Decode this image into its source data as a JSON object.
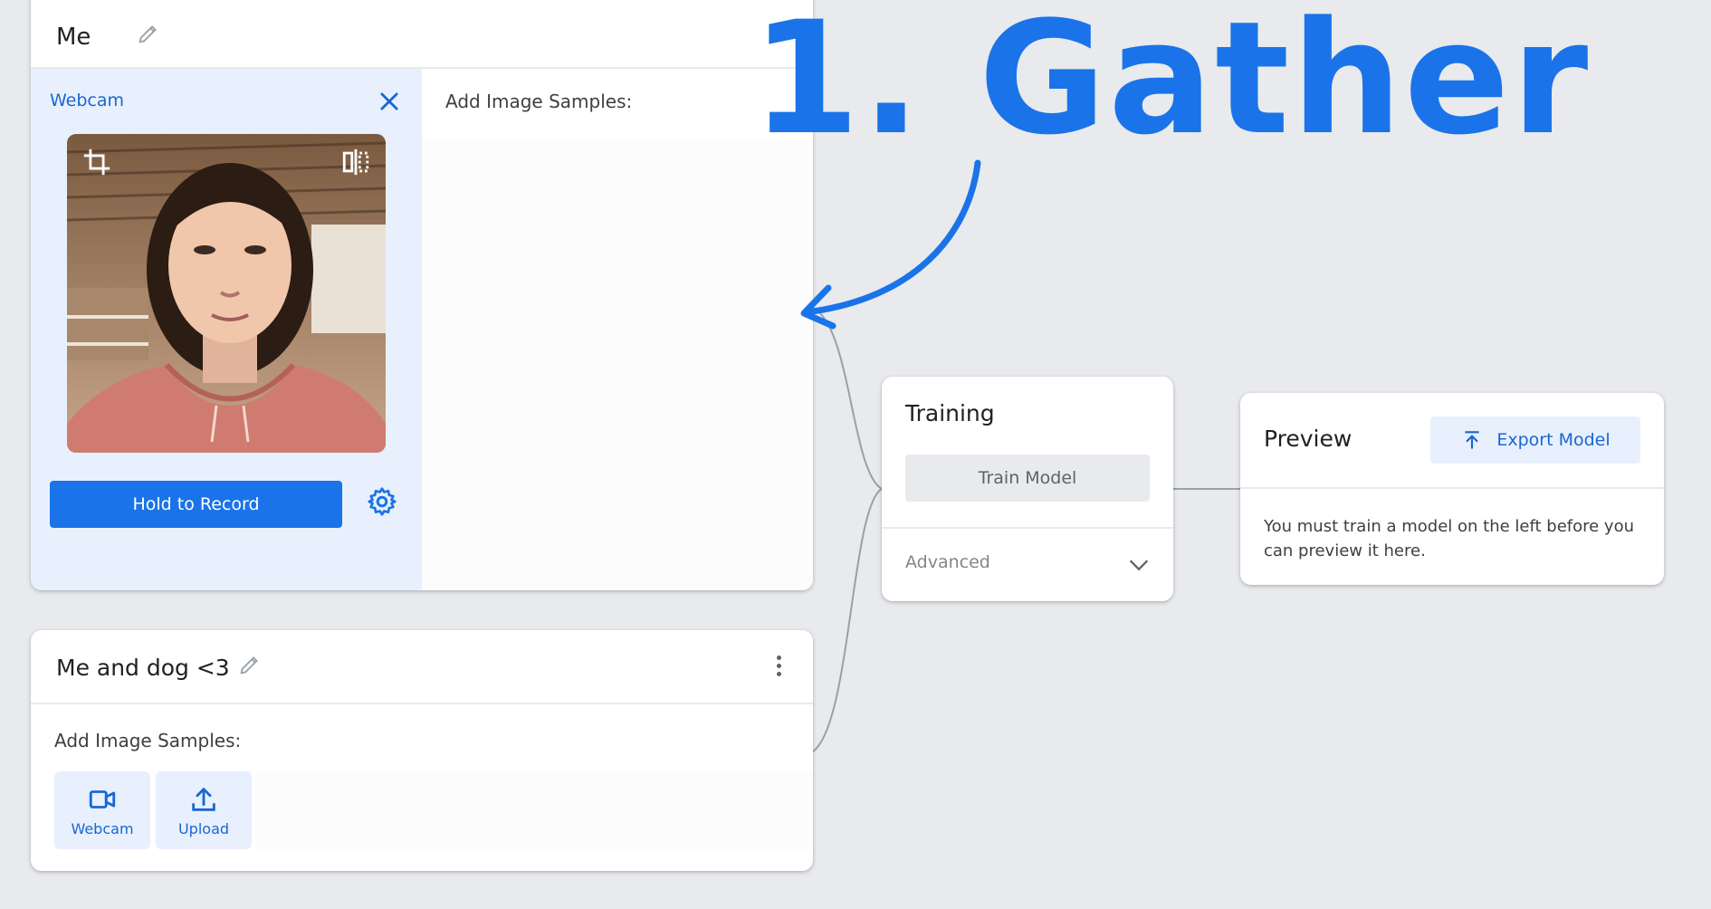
{
  "annotation": {
    "headline": "1. Gather"
  },
  "class_cards": [
    {
      "name": "Me",
      "webcam_label": "Webcam",
      "record_button": "Hold to Record",
      "samples_label": "Add Image Samples:"
    },
    {
      "name": "Me and dog <3",
      "samples_label": "Add Image Samples:",
      "webcam_button": "Webcam",
      "upload_button": "Upload"
    }
  ],
  "training": {
    "title": "Training",
    "train_button": "Train Model",
    "advanced_label": "Advanced"
  },
  "preview": {
    "title": "Preview",
    "export_button": "Export Model",
    "message": "You must train a model on the left before you can preview it here."
  },
  "colors": {
    "accent": "#1a73e8",
    "accent_text": "#1967d2",
    "accent_light": "#e8f0fe",
    "background": "#e8eaed"
  },
  "icons": [
    "pencil-icon",
    "close-icon",
    "crop-icon",
    "flip-icon",
    "settings-icon",
    "more-vert-icon",
    "videocam-icon",
    "upload-icon",
    "chevron-down-icon"
  ]
}
